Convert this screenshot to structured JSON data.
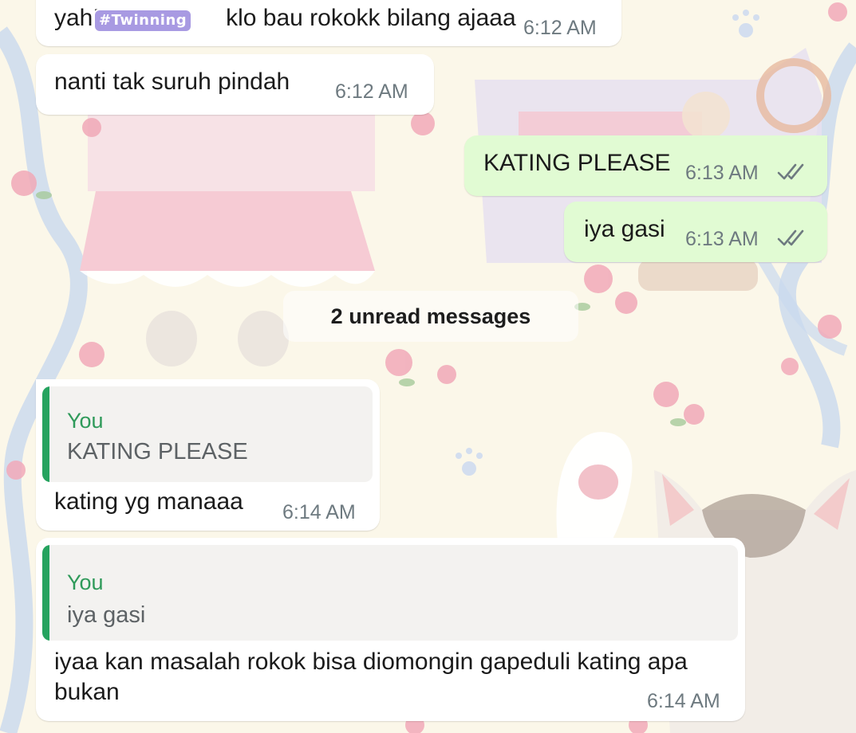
{
  "colors": {
    "incoming_bubble": "#ffffff",
    "outgoing_bubble": "#e1fbd3",
    "quote_bar": "#25a35f",
    "quote_author": "#2f9a5a",
    "read_ticks": "#6e7a80"
  },
  "sticker": {
    "text": "#Twinning"
  },
  "messages": [
    {
      "direction": "incoming",
      "text": "yah!                   klo bau rokokk bilang ajaaa",
      "time": "6:12 AM"
    },
    {
      "direction": "incoming",
      "text": "nanti tak suruh pindah",
      "time": "6:12 AM"
    },
    {
      "direction": "outgoing",
      "text": "KATING PLEASE",
      "time": "6:13 AM",
      "status_icon": "double-check-icon"
    },
    {
      "direction": "outgoing",
      "text": "iya gasi",
      "time": "6:13 AM",
      "status_icon": "double-check-icon"
    },
    {
      "direction": "incoming",
      "quote": {
        "author": "You",
        "text": "KATING PLEASE"
      },
      "text": "kating yg manaaa",
      "time": "6:14 AM"
    },
    {
      "direction": "incoming",
      "quote": {
        "author": "You",
        "text": "iya gasi"
      },
      "text": "iyaa kan masalah rokok bisa diomongin gapeduli kating apa bukan",
      "time": "6:14 AM"
    }
  ],
  "unread_divider": {
    "label": "2 unread messages"
  }
}
